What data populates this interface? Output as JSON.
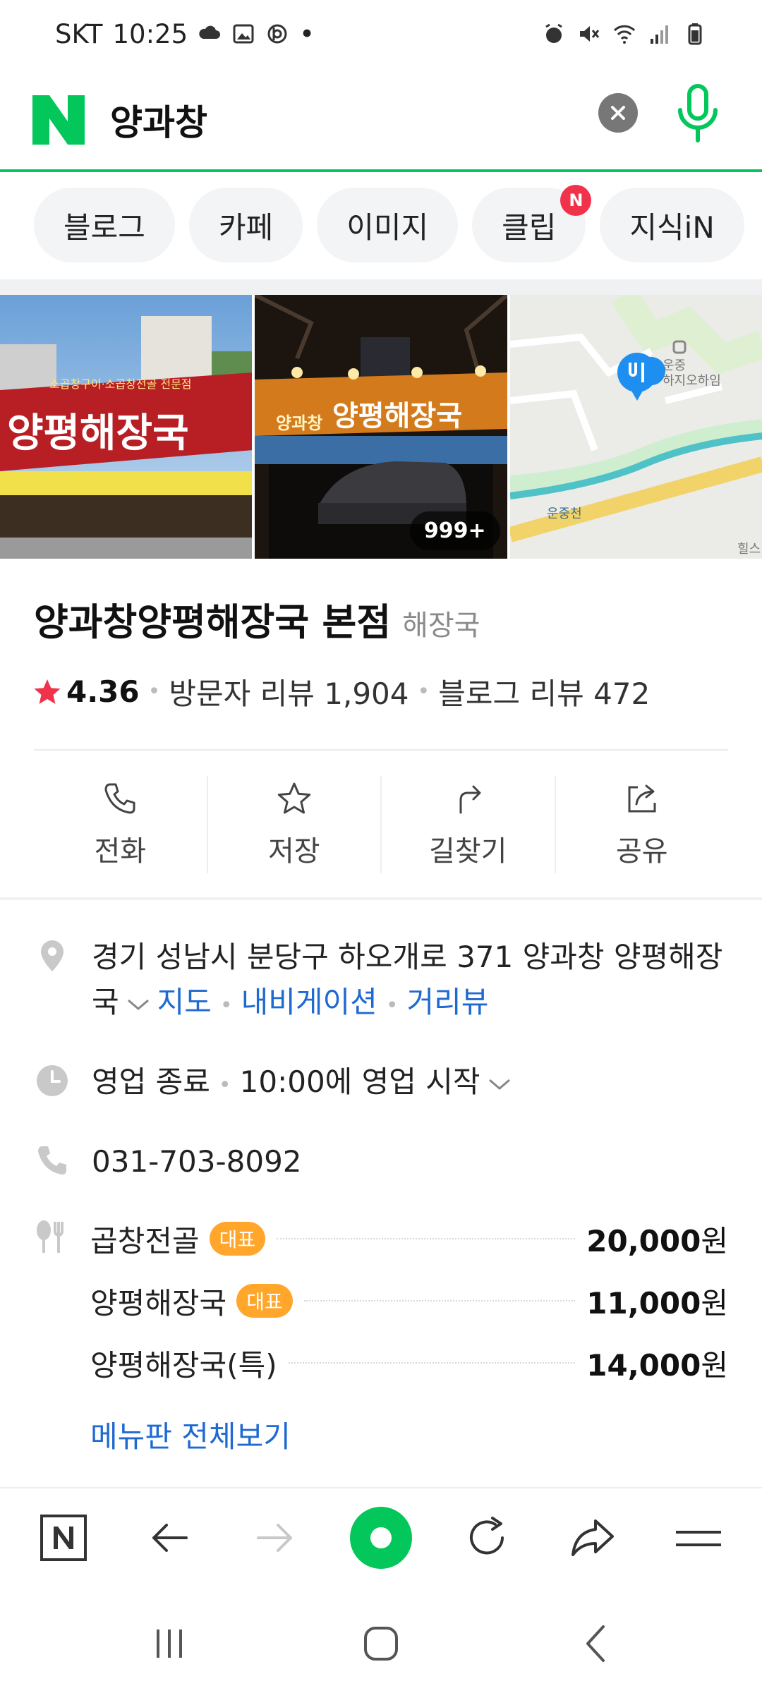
{
  "status_bar": {
    "carrier": "SKT",
    "time": "10:25",
    "dot": "•"
  },
  "search": {
    "query": "양과창"
  },
  "tabs": [
    {
      "label": "블로그"
    },
    {
      "label": "카페"
    },
    {
      "label": "이미지"
    },
    {
      "label": "클립",
      "badge": "N"
    },
    {
      "label": "지식iN"
    }
  ],
  "photos": {
    "photo1_sign": "양평해장국",
    "photo1_banner": "소곱창구이·소곱창전골 전문점",
    "photo2_sign": "양평해장국",
    "photo2_logo": "양과창",
    "count": "999+",
    "map_label_poi": "운중\n하지오하임",
    "map_label_stream": "운중천",
    "map_label_corner": "힐스"
  },
  "place": {
    "name": "양과창양평해장국 본점",
    "category": "해장국",
    "rating": "4.36",
    "visitor_review": "방문자 리뷰 1,904",
    "blog_review": "블로그 리뷰 472"
  },
  "actions": [
    {
      "label": "전화"
    },
    {
      "label": "저장"
    },
    {
      "label": "길찾기"
    },
    {
      "label": "공유"
    }
  ],
  "details": {
    "address": "경기 성남시 분당구 하오개로 371 양과창 양평해장국",
    "map_link": "지도",
    "nav_link": "내비게이션",
    "street_link": "거리뷰",
    "hours_status": "영업 종료",
    "hours_next": "10:00에 영업 시작",
    "phone": "031-703-8092"
  },
  "menu": {
    "items": [
      {
        "name": "곱창전골",
        "badge": "대표",
        "price": "20,000",
        "unit": "원"
      },
      {
        "name": "양평해장국",
        "badge": "대표",
        "price": "11,000",
        "unit": "원"
      },
      {
        "name": "양평해장국(특)",
        "badge": "",
        "price": "14,000",
        "unit": "원"
      }
    ],
    "more": "메뉴판 전체보기"
  },
  "colors": {
    "naver_green": "#03c75a",
    "link_blue": "#1f6ad1",
    "badge_orange": "#ffa62b",
    "star_red": "#f0334b"
  },
  "icons": [
    "naver-n-icon",
    "clear-icon",
    "mic-icon",
    "phone-icon",
    "star-icon",
    "directions-icon",
    "share-icon",
    "location-pin-icon",
    "clock-icon",
    "fork-knife-icon",
    "back-icon",
    "forward-icon",
    "refresh-icon",
    "menu-icon"
  ]
}
